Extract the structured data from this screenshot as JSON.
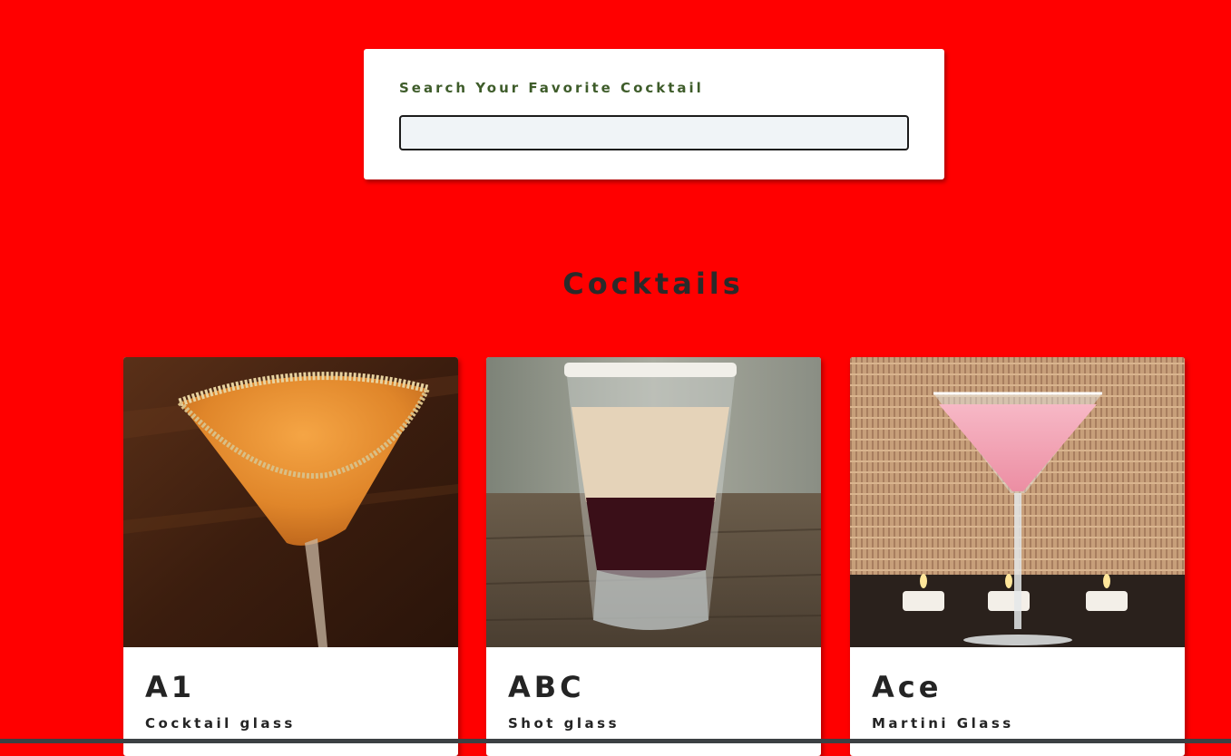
{
  "search": {
    "label": "Search Your Favorite Cocktail",
    "value": "",
    "placeholder": ""
  },
  "section": {
    "title": "Cocktails"
  },
  "cocktails": [
    {
      "name": "A1",
      "glass": "Cocktail glass",
      "image": "amber-cocktail-photo"
    },
    {
      "name": "ABC",
      "glass": "Shot glass",
      "image": "layered-shot-photo"
    },
    {
      "name": "Ace",
      "glass": "Martini Glass",
      "image": "pink-martini-photo"
    }
  ],
  "colors": {
    "background": "#ff0000",
    "label": "#3e5c2a",
    "text": "#242424",
    "card": "#ffffff",
    "input_bg": "#f0f4f7"
  }
}
